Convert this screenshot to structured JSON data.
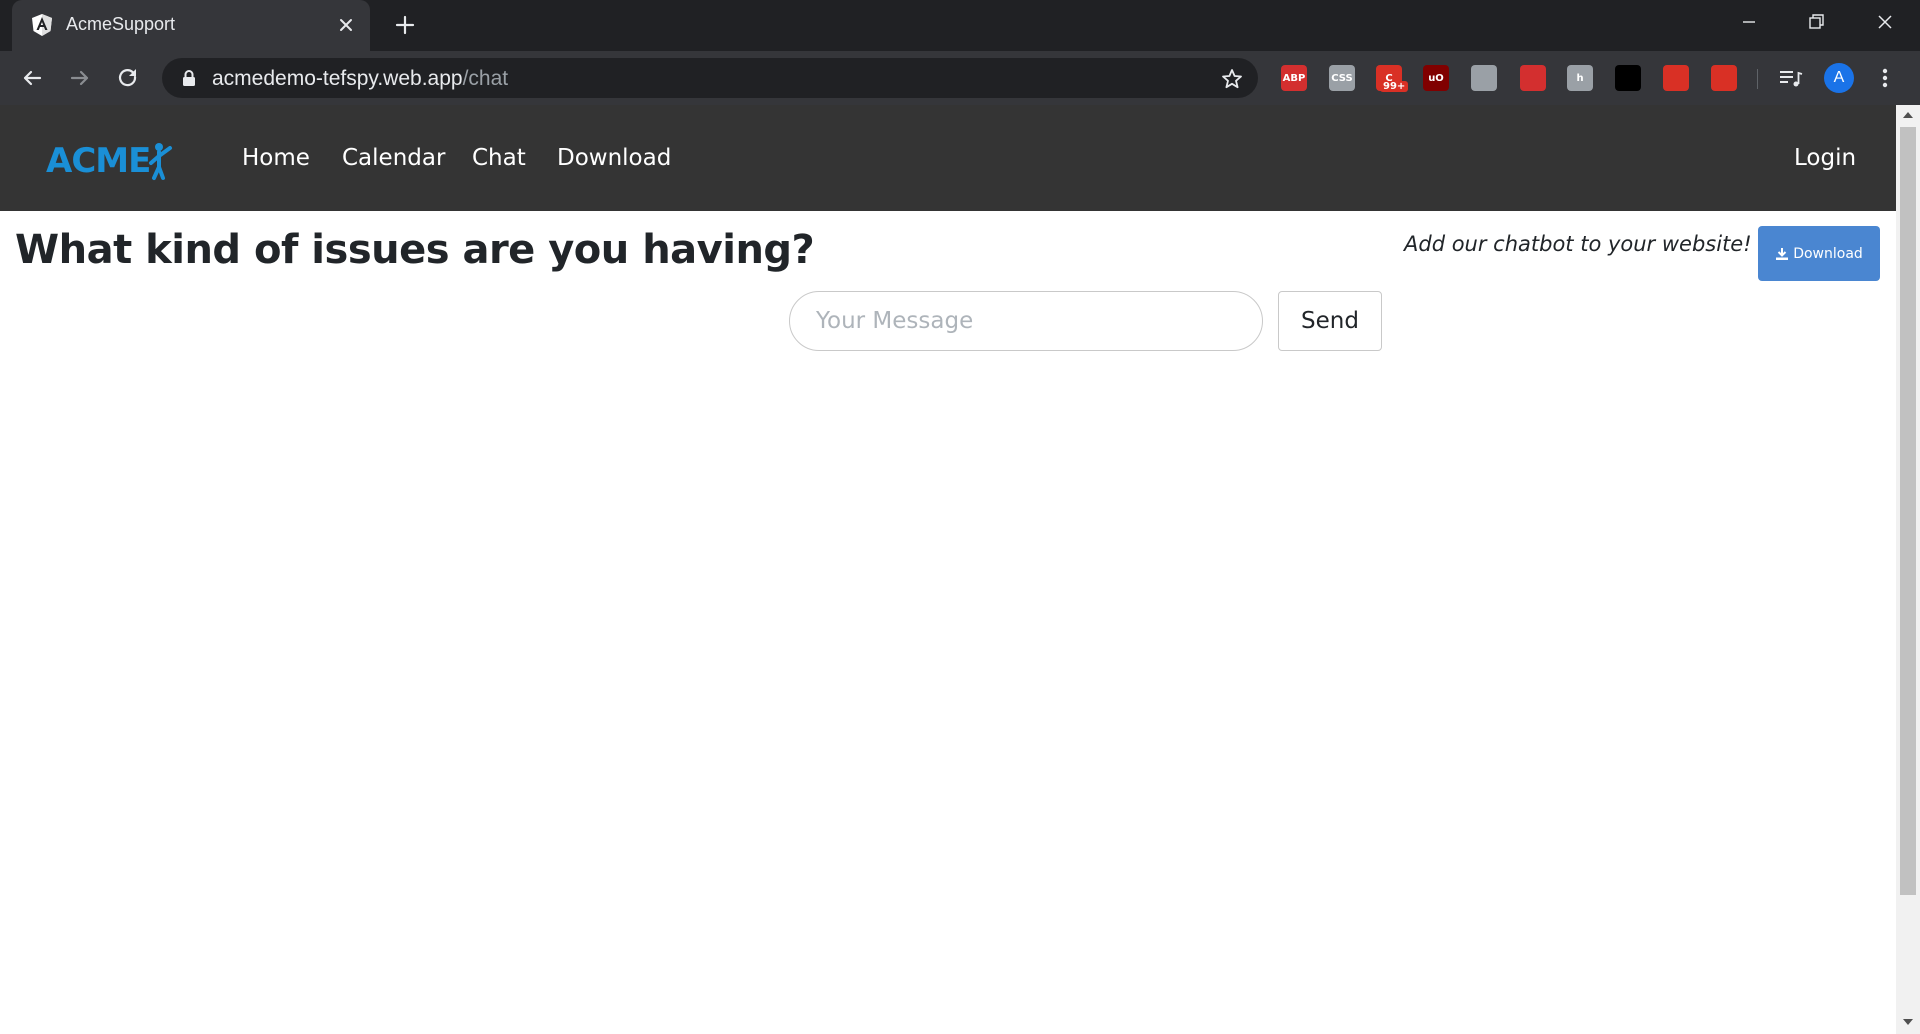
{
  "browser": {
    "tab_title": "AcmeSupport",
    "url_host": "acmedemo-tefspy.web.app",
    "url_path": "/chat",
    "profile_initial": "A",
    "extensions": [
      {
        "name": "abp-icon",
        "label": "ABP",
        "color": "#d32f2f"
      },
      {
        "name": "css-icon",
        "label": "CSS",
        "color": "#9aa0a6"
      },
      {
        "name": "notification-extension-icon",
        "label": "C",
        "color": "#d93025",
        "badge": "99+"
      },
      {
        "name": "ublock-icon",
        "label": "uO",
        "color": "#800000"
      },
      {
        "name": "camera-icon",
        "label": "",
        "color": "#9aa0a6"
      },
      {
        "name": "reader-icon",
        "label": "",
        "color": "#d32f2f"
      },
      {
        "name": "hint-icon",
        "label": "h",
        "color": "#9aa0a6"
      },
      {
        "name": "lock-extension-icon",
        "label": "",
        "color": "#000000"
      },
      {
        "name": "window-icon",
        "label": "",
        "color": "#d93025"
      },
      {
        "name": "gift-icon",
        "label": "",
        "color": "#d93025"
      }
    ]
  },
  "navbar": {
    "brand": "ACME",
    "links": [
      "Home",
      "Calendar",
      "Chat",
      "Download"
    ],
    "login": "Login"
  },
  "main": {
    "heading": "What kind of issues are you having?",
    "promo": "Add our chatbot to your website!",
    "download_label": "Download",
    "message_placeholder": "Your Message",
    "message_value": "",
    "send_label": "Send"
  },
  "colors": {
    "navbar_bg": "#343434",
    "brand_blue": "#1a8fd6",
    "download_button": "#4a86d1"
  }
}
